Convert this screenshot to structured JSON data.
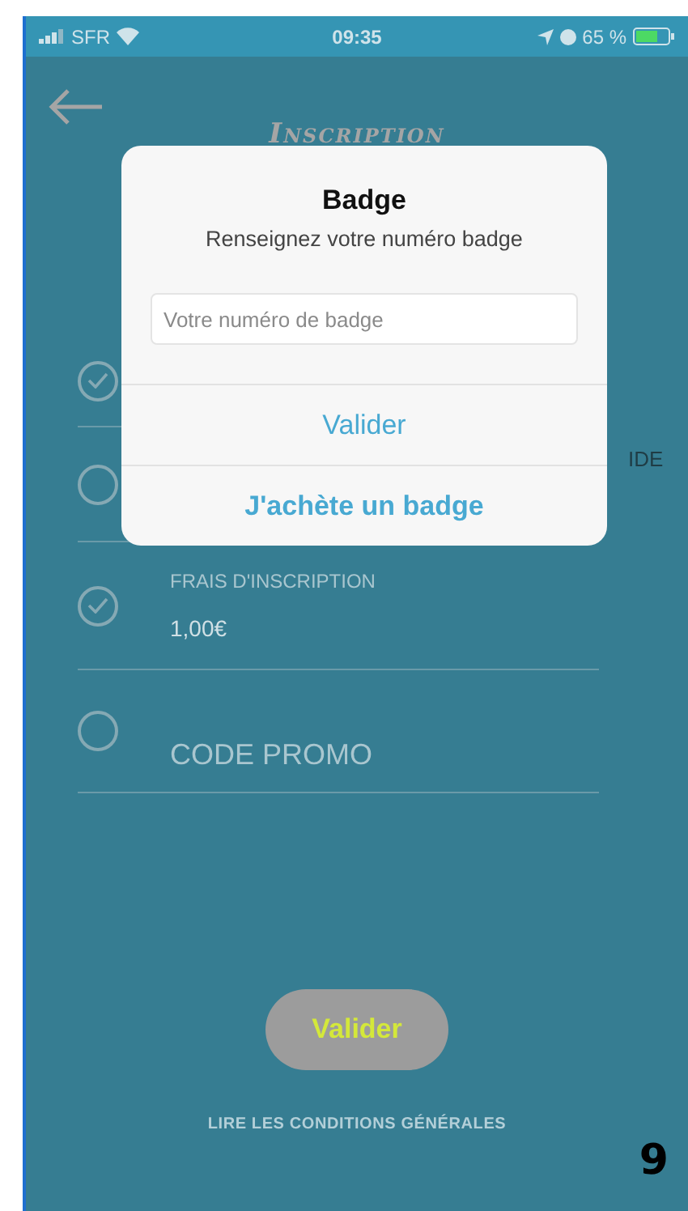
{
  "status_bar": {
    "carrier": "SFR",
    "time": "09:35",
    "battery_percent": "65 %"
  },
  "header": {
    "title": "Inscription"
  },
  "rows": [
    {
      "checked": true,
      "label": "",
      "value": "",
      "side_text": ""
    },
    {
      "checked": false,
      "label": "",
      "value": "",
      "side_text": "IDE"
    },
    {
      "checked": true,
      "label": "FRAIS D'INSCRIPTION",
      "value": "1,00€",
      "side_text": ""
    },
    {
      "checked": false,
      "label": "",
      "value": "CODE PROMO",
      "side_text": ""
    }
  ],
  "submit_button": "Valider",
  "terms_link": "LIRE LES **CONDITIONS GÉNÉRALES**",
  "page_number": "9",
  "dialog": {
    "title": "Badge",
    "message": "Renseignez votre numéro badge",
    "input": {
      "placeholder": "Votre numéro de badge"
    },
    "actions": [
      {
        "label": "Valider",
        "kind": "normal"
      },
      {
        "label": "J'achète un badge",
        "kind": "primary"
      }
    ]
  }
}
